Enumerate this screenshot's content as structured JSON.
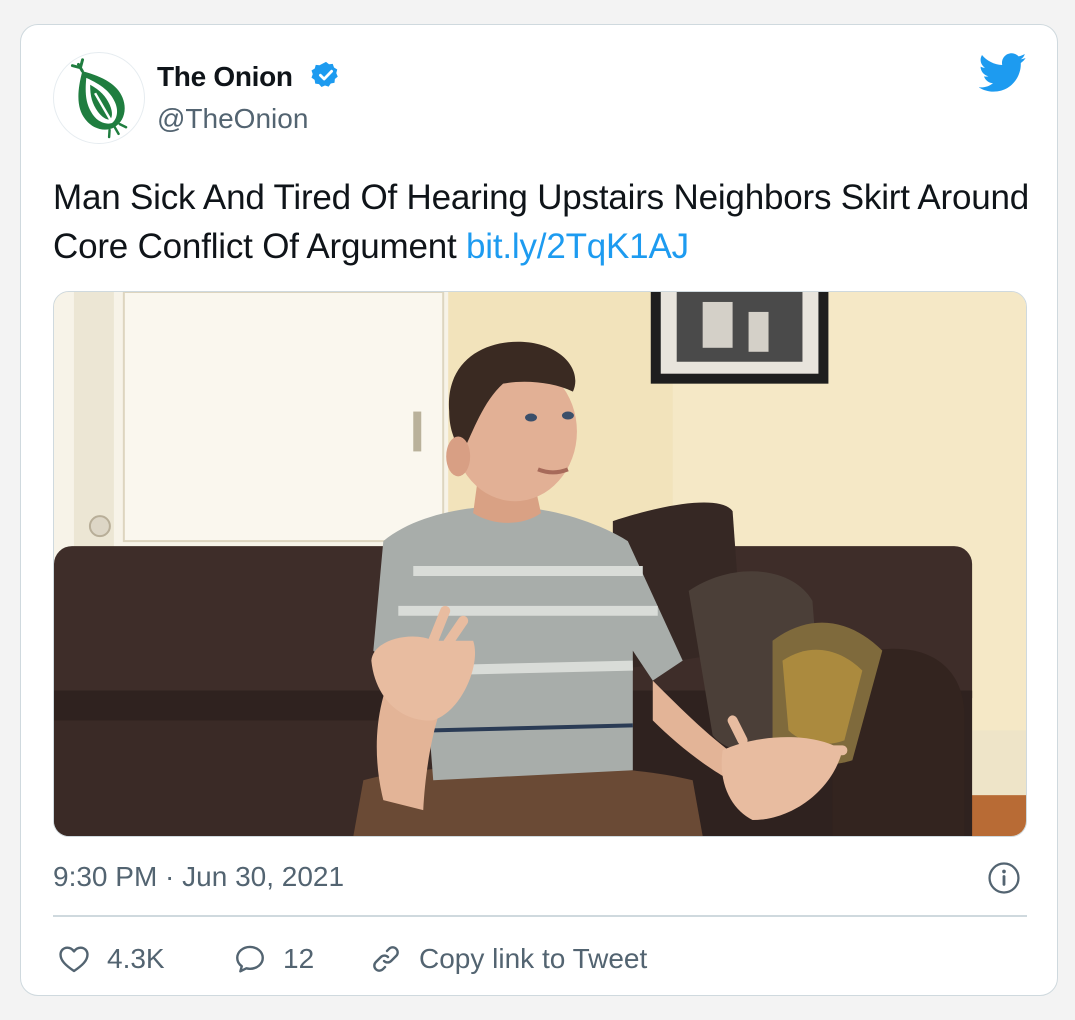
{
  "author": {
    "display_name": "The Onion",
    "handle": "@TheOnion",
    "verified": true,
    "avatar_icon": "onion-logo-icon",
    "brand_color": "#1f7d3f"
  },
  "tweet": {
    "text": "Man Sick And Tired Of Hearing Upstairs Neighbors Skirt Around Core Conflict Of Argument ",
    "link": "bit.ly/2TqK1AJ",
    "timestamp": "9:30 PM · Jun 30, 2021"
  },
  "actions": {
    "likes": "4.3K",
    "replies": "12",
    "copy_link_label": "Copy link to Tweet"
  },
  "icons": {
    "platform": "twitter-bird-icon",
    "verified": "verified-badge-icon",
    "info": "info-icon",
    "like": "heart-icon",
    "reply": "speech-bubble-icon",
    "copy": "link-icon"
  },
  "colors": {
    "link": "#1d9bf0",
    "muted": "#536471",
    "text": "#0f1419",
    "border": "#cfd9de"
  }
}
